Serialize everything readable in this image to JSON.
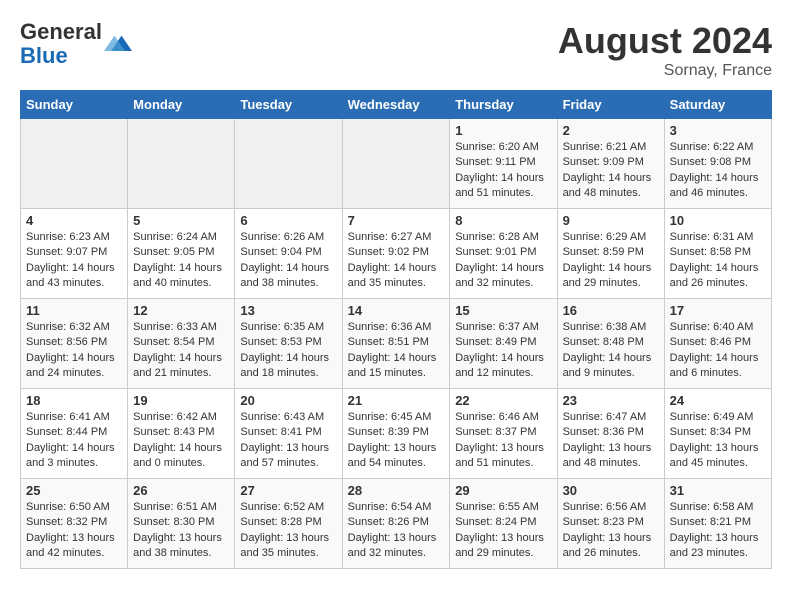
{
  "header": {
    "logo_line1": "General",
    "logo_line2": "Blue",
    "month_year": "August 2024",
    "location": "Sornay, France"
  },
  "days_of_week": [
    "Sunday",
    "Monday",
    "Tuesday",
    "Wednesday",
    "Thursday",
    "Friday",
    "Saturday"
  ],
  "weeks": [
    [
      {
        "day": "",
        "info": ""
      },
      {
        "day": "",
        "info": ""
      },
      {
        "day": "",
        "info": ""
      },
      {
        "day": "",
        "info": ""
      },
      {
        "day": "1",
        "info": "Sunrise: 6:20 AM\nSunset: 9:11 PM\nDaylight: 14 hours\nand 51 minutes."
      },
      {
        "day": "2",
        "info": "Sunrise: 6:21 AM\nSunset: 9:09 PM\nDaylight: 14 hours\nand 48 minutes."
      },
      {
        "day": "3",
        "info": "Sunrise: 6:22 AM\nSunset: 9:08 PM\nDaylight: 14 hours\nand 46 minutes."
      }
    ],
    [
      {
        "day": "4",
        "info": "Sunrise: 6:23 AM\nSunset: 9:07 PM\nDaylight: 14 hours\nand 43 minutes."
      },
      {
        "day": "5",
        "info": "Sunrise: 6:24 AM\nSunset: 9:05 PM\nDaylight: 14 hours\nand 40 minutes."
      },
      {
        "day": "6",
        "info": "Sunrise: 6:26 AM\nSunset: 9:04 PM\nDaylight: 14 hours\nand 38 minutes."
      },
      {
        "day": "7",
        "info": "Sunrise: 6:27 AM\nSunset: 9:02 PM\nDaylight: 14 hours\nand 35 minutes."
      },
      {
        "day": "8",
        "info": "Sunrise: 6:28 AM\nSunset: 9:01 PM\nDaylight: 14 hours\nand 32 minutes."
      },
      {
        "day": "9",
        "info": "Sunrise: 6:29 AM\nSunset: 8:59 PM\nDaylight: 14 hours\nand 29 minutes."
      },
      {
        "day": "10",
        "info": "Sunrise: 6:31 AM\nSunset: 8:58 PM\nDaylight: 14 hours\nand 26 minutes."
      }
    ],
    [
      {
        "day": "11",
        "info": "Sunrise: 6:32 AM\nSunset: 8:56 PM\nDaylight: 14 hours\nand 24 minutes."
      },
      {
        "day": "12",
        "info": "Sunrise: 6:33 AM\nSunset: 8:54 PM\nDaylight: 14 hours\nand 21 minutes."
      },
      {
        "day": "13",
        "info": "Sunrise: 6:35 AM\nSunset: 8:53 PM\nDaylight: 14 hours\nand 18 minutes."
      },
      {
        "day": "14",
        "info": "Sunrise: 6:36 AM\nSunset: 8:51 PM\nDaylight: 14 hours\nand 15 minutes."
      },
      {
        "day": "15",
        "info": "Sunrise: 6:37 AM\nSunset: 8:49 PM\nDaylight: 14 hours\nand 12 minutes."
      },
      {
        "day": "16",
        "info": "Sunrise: 6:38 AM\nSunset: 8:48 PM\nDaylight: 14 hours\nand 9 minutes."
      },
      {
        "day": "17",
        "info": "Sunrise: 6:40 AM\nSunset: 8:46 PM\nDaylight: 14 hours\nand 6 minutes."
      }
    ],
    [
      {
        "day": "18",
        "info": "Sunrise: 6:41 AM\nSunset: 8:44 PM\nDaylight: 14 hours\nand 3 minutes."
      },
      {
        "day": "19",
        "info": "Sunrise: 6:42 AM\nSunset: 8:43 PM\nDaylight: 14 hours\nand 0 minutes."
      },
      {
        "day": "20",
        "info": "Sunrise: 6:43 AM\nSunset: 8:41 PM\nDaylight: 13 hours\nand 57 minutes."
      },
      {
        "day": "21",
        "info": "Sunrise: 6:45 AM\nSunset: 8:39 PM\nDaylight: 13 hours\nand 54 minutes."
      },
      {
        "day": "22",
        "info": "Sunrise: 6:46 AM\nSunset: 8:37 PM\nDaylight: 13 hours\nand 51 minutes."
      },
      {
        "day": "23",
        "info": "Sunrise: 6:47 AM\nSunset: 8:36 PM\nDaylight: 13 hours\nand 48 minutes."
      },
      {
        "day": "24",
        "info": "Sunrise: 6:49 AM\nSunset: 8:34 PM\nDaylight: 13 hours\nand 45 minutes."
      }
    ],
    [
      {
        "day": "25",
        "info": "Sunrise: 6:50 AM\nSunset: 8:32 PM\nDaylight: 13 hours\nand 42 minutes."
      },
      {
        "day": "26",
        "info": "Sunrise: 6:51 AM\nSunset: 8:30 PM\nDaylight: 13 hours\nand 38 minutes."
      },
      {
        "day": "27",
        "info": "Sunrise: 6:52 AM\nSunset: 8:28 PM\nDaylight: 13 hours\nand 35 minutes."
      },
      {
        "day": "28",
        "info": "Sunrise: 6:54 AM\nSunset: 8:26 PM\nDaylight: 13 hours\nand 32 minutes."
      },
      {
        "day": "29",
        "info": "Sunrise: 6:55 AM\nSunset: 8:24 PM\nDaylight: 13 hours\nand 29 minutes."
      },
      {
        "day": "30",
        "info": "Sunrise: 6:56 AM\nSunset: 8:23 PM\nDaylight: 13 hours\nand 26 minutes."
      },
      {
        "day": "31",
        "info": "Sunrise: 6:58 AM\nSunset: 8:21 PM\nDaylight: 13 hours\nand 23 minutes."
      }
    ]
  ]
}
